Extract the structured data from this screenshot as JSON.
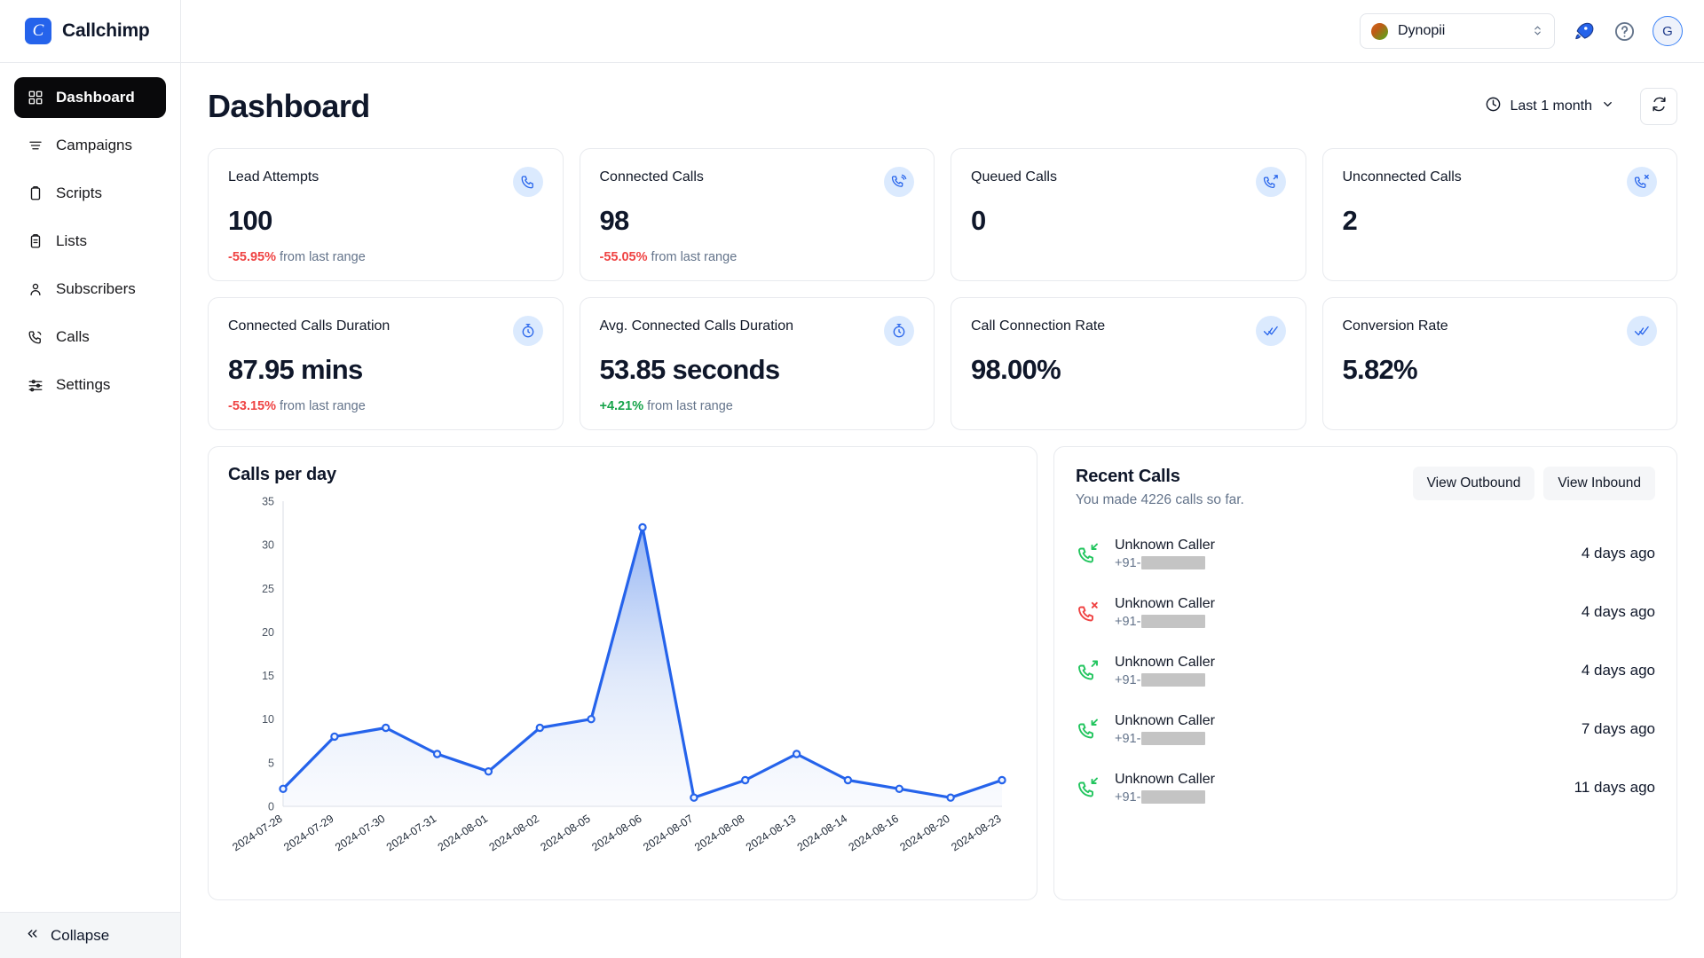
{
  "brand": {
    "name": "Callchimp",
    "logo_letter": "C",
    "logo_color": "#2563eb"
  },
  "sidebar": {
    "items": [
      {
        "label": "Dashboard",
        "icon": "grid-icon",
        "active": true
      },
      {
        "label": "Campaigns",
        "icon": "list-icon",
        "active": false
      },
      {
        "label": "Scripts",
        "icon": "clipboard-icon",
        "active": false
      },
      {
        "label": "Lists",
        "icon": "list-checklist-icon",
        "active": false
      },
      {
        "label": "Subscribers",
        "icon": "user-icon",
        "active": false
      },
      {
        "label": "Calls",
        "icon": "phone-icon",
        "active": false
      },
      {
        "label": "Settings",
        "icon": "sliders-icon",
        "active": false
      }
    ],
    "collapse_label": "Collapse"
  },
  "topbar": {
    "org_name": "Dynopii",
    "rocket_icon": "rocket-icon",
    "help_icon": "help-circle-icon",
    "avatar_initial": "G"
  },
  "page": {
    "title": "Dashboard",
    "range_label": "Last 1 month",
    "refresh_icon": "refresh-icon"
  },
  "stats": [
    {
      "label": "Lead Attempts",
      "value": "100",
      "delta": "-55.95%",
      "delta_dir": "neg",
      "delta_suffix": "from last range",
      "icon": "phone-icon"
    },
    {
      "label": "Connected Calls",
      "value": "98",
      "delta": "-55.05%",
      "delta_dir": "neg",
      "delta_suffix": "from last range",
      "icon": "phone-connected-icon"
    },
    {
      "label": "Queued Calls",
      "value": "0",
      "delta": "",
      "delta_dir": "",
      "delta_suffix": "",
      "icon": "phone-outgoing-icon"
    },
    {
      "label": "Unconnected Calls",
      "value": "2",
      "delta": "",
      "delta_dir": "",
      "delta_suffix": "",
      "icon": "phone-missed-icon"
    },
    {
      "label": "Connected Calls Duration",
      "value": "87.95 mins",
      "delta": "-53.15%",
      "delta_dir": "neg",
      "delta_suffix": "from last range",
      "icon": "stopwatch-icon"
    },
    {
      "label": "Avg. Connected Calls Duration",
      "value": "53.85 seconds",
      "delta": "+4.21%",
      "delta_dir": "pos",
      "delta_suffix": "from last range",
      "icon": "stopwatch-icon"
    },
    {
      "label": "Call Connection Rate",
      "value": "98.00%",
      "delta": "",
      "delta_dir": "",
      "delta_suffix": "",
      "icon": "double-check-icon"
    },
    {
      "label": "Conversion Rate",
      "value": "5.82%",
      "delta": "",
      "delta_dir": "",
      "delta_suffix": "",
      "icon": "double-check-icon"
    }
  ],
  "chart_panel": {
    "title": "Calls per day"
  },
  "chart_data": {
    "type": "area",
    "title": "Calls per day",
    "xlabel": "",
    "ylabel": "",
    "ylim": [
      0,
      35
    ],
    "yticks": [
      0,
      5,
      10,
      15,
      20,
      25,
      30,
      35
    ],
    "grid": false,
    "legend": "none",
    "line_color": "#2563eb",
    "categories": [
      "2024-07-28",
      "2024-07-29",
      "2024-07-30",
      "2024-07-31",
      "2024-08-01",
      "2024-08-02",
      "2024-08-05",
      "2024-08-06",
      "2024-08-07",
      "2024-08-08",
      "2024-08-13",
      "2024-08-14",
      "2024-08-16",
      "2024-08-20",
      "2024-08-23"
    ],
    "values": [
      2,
      8,
      9,
      6,
      4,
      9,
      10,
      32,
      1,
      3,
      6,
      3,
      2,
      1,
      3
    ]
  },
  "recent": {
    "title": "Recent Calls",
    "subtitle": "You made 4226 calls so far.",
    "view_outbound_label": "View Outbound",
    "view_inbound_label": "View Inbound",
    "calls": [
      {
        "name": "Unknown Caller",
        "prefix": "+91-",
        "time": "4 days ago",
        "type": "in"
      },
      {
        "name": "Unknown Caller",
        "prefix": "+91-",
        "time": "4 days ago",
        "type": "missed"
      },
      {
        "name": "Unknown Caller",
        "prefix": "+91-",
        "time": "4 days ago",
        "type": "out"
      },
      {
        "name": "Unknown Caller",
        "prefix": "+91-",
        "time": "7 days ago",
        "type": "in"
      },
      {
        "name": "Unknown Caller",
        "prefix": "+91-",
        "time": "11 days ago",
        "type": "in"
      }
    ]
  }
}
